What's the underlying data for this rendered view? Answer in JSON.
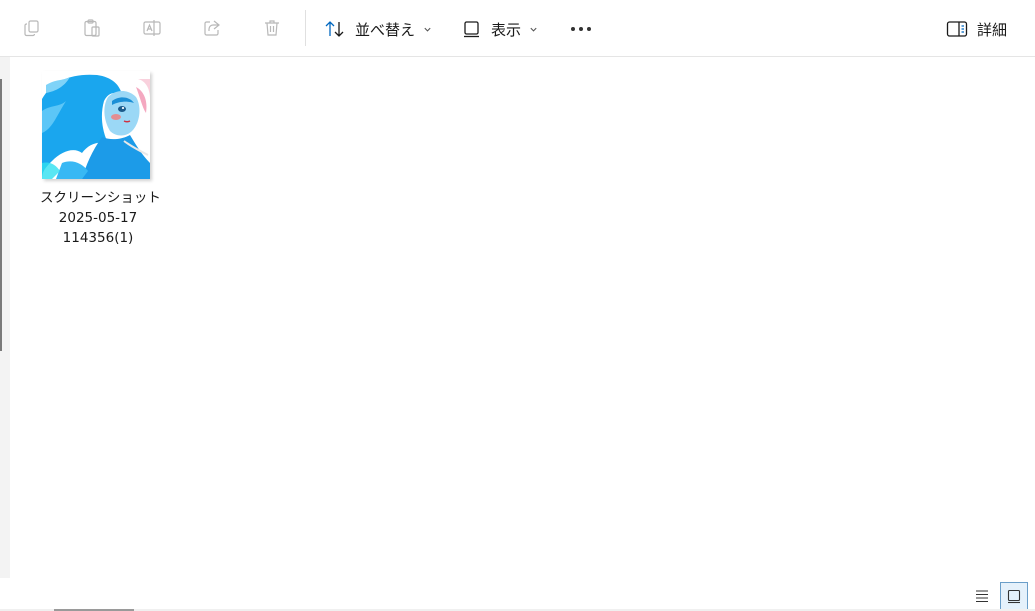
{
  "toolbar": {
    "sort_label": "並べ替え",
    "view_label": "表示",
    "details_label": "詳細",
    "icons": [
      "copy-icon",
      "paste-icon",
      "rename-icon",
      "share-icon",
      "delete-icon",
      "sort-icon",
      "view-icon",
      "more-icon",
      "details-pane-icon"
    ]
  },
  "files": [
    {
      "name_line1": "スクリーンショット",
      "name_line2": "2025-05-17",
      "name_line3": "114356(1)"
    }
  ],
  "statusbar": {
    "views": [
      "details-view-icon",
      "large-icons-view-icon"
    ],
    "active_view": "large-icons-view-icon"
  },
  "colors": {
    "accent": "#0067c0",
    "disabled_icon": "#b8b8b8",
    "thumb_blue": "#1ea8f0"
  }
}
